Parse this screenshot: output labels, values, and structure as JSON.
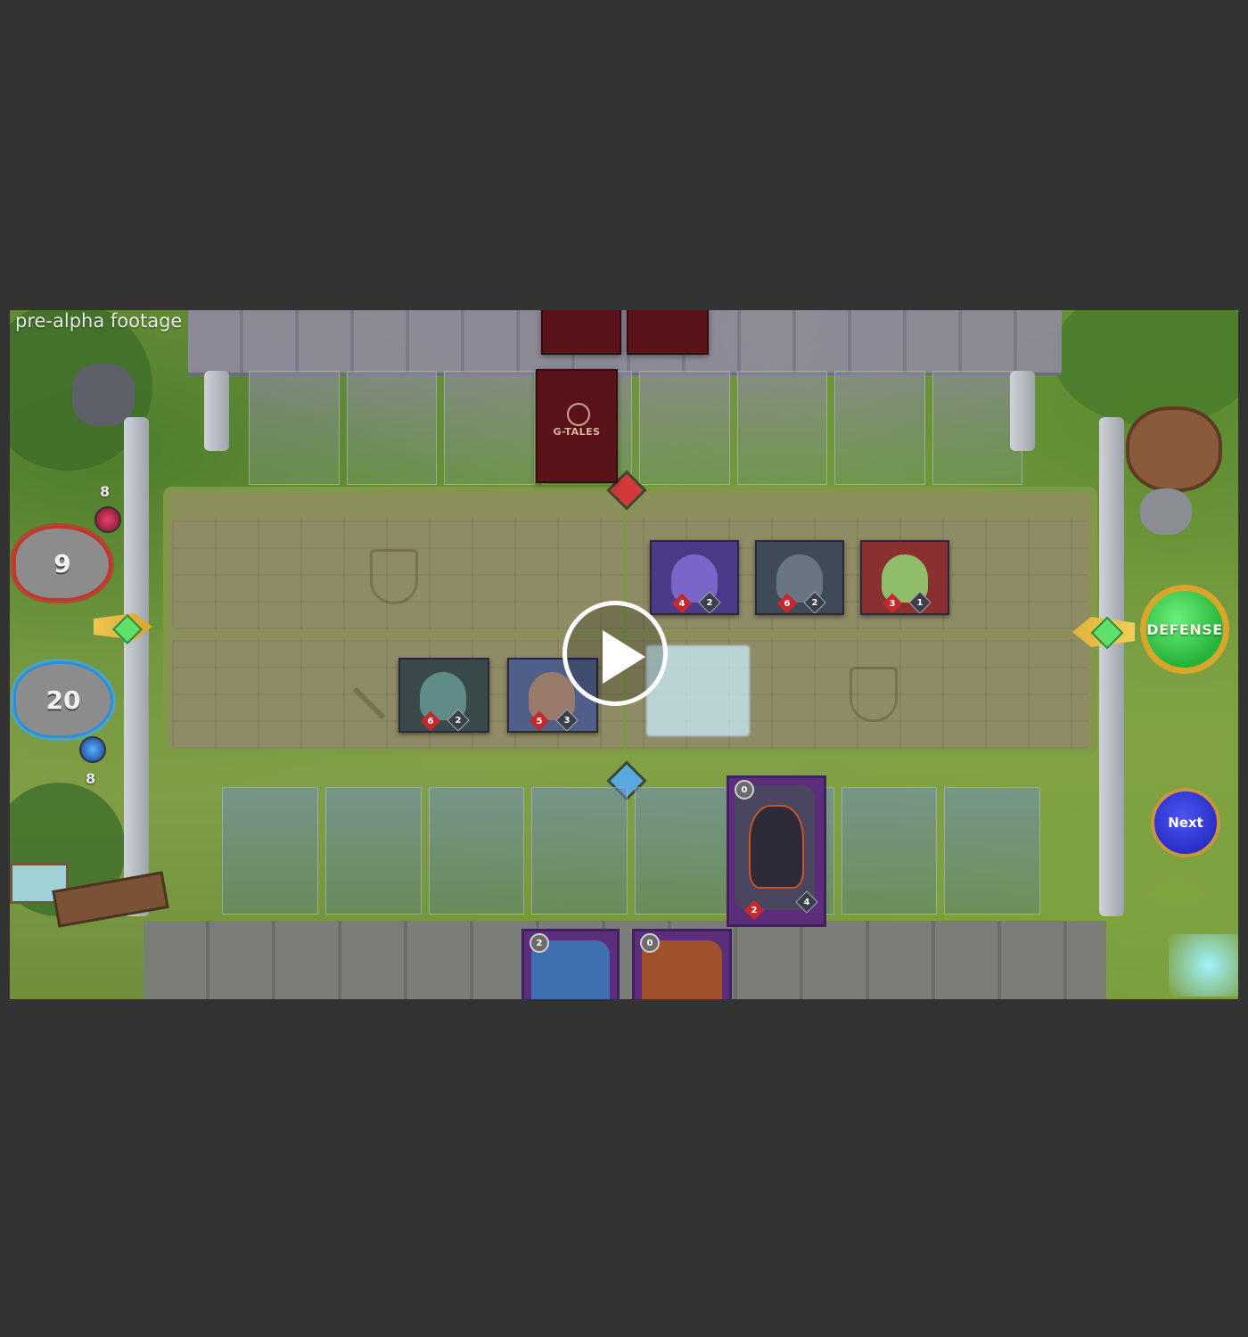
{
  "overlay": {
    "watermark": "pre-alpha footage"
  },
  "deck": {
    "logo_text": "G-TALES"
  },
  "opponent": {
    "health": "9",
    "resource": "8"
  },
  "player": {
    "health": "20",
    "resource": "8"
  },
  "opponent_units": [
    {
      "attack": "4",
      "health": "2",
      "art_color": "#4b3a88",
      "figure_color": "#7a66c8"
    },
    {
      "attack": "6",
      "health": "2",
      "art_color": "#3f4a58",
      "figure_color": "#6a7482"
    },
    {
      "attack": "3",
      "health": "1",
      "art_color": "#8a3030",
      "figure_color": "#8fbd6a"
    }
  ],
  "player_units": [
    {
      "attack": "6",
      "health": "2",
      "art_color": "#3a4a4a",
      "figure_color": "#5f8c88"
    },
    {
      "attack": "5",
      "health": "3",
      "art_color": "#4f5f8a",
      "figure_color": "#9a7a6a"
    }
  ],
  "selected_card": {
    "cost": "0",
    "attack": "2",
    "health": "4"
  },
  "hand_cards": [
    {
      "cost": "2",
      "art_color": "#3f6fb0"
    },
    {
      "cost": "0",
      "art_color": "#a0522d"
    }
  ],
  "buttons": {
    "defense_label": "DEFENSE",
    "next_label": "Next"
  },
  "colors": {
    "defense": "#26b33a",
    "next": "#2a2fc8",
    "frame_gold": "#d9a52a",
    "deck_red": "#5a1419"
  },
  "icons": {
    "play": "play-icon",
    "shield": "shield-icon",
    "sword": "sword-icon"
  }
}
